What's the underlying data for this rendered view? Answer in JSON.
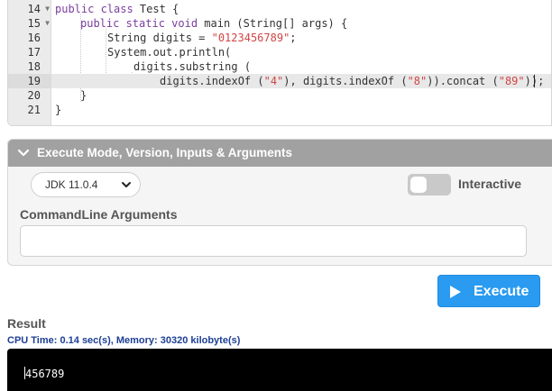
{
  "editor": {
    "lines": [
      {
        "num": "14",
        "fold": true
      },
      {
        "num": "15",
        "fold": true
      },
      {
        "num": "16",
        "fold": false
      },
      {
        "num": "17",
        "fold": false
      },
      {
        "num": "18",
        "fold": false
      },
      {
        "num": "19",
        "fold": false
      },
      {
        "num": "20",
        "fold": false
      },
      {
        "num": "21",
        "fold": false
      }
    ],
    "tokens": {
      "l14_kw": "public class",
      "l14_rest": " Test {",
      "l15_kw": "public static void",
      "l15_rest": " main (String[] args) {",
      "l16_a": "String digits = ",
      "l16_str": "\"0123456789\"",
      "l16_b": ";",
      "l17": "System.out.println(",
      "l18": "digits.substring (",
      "l19_a": "digits.indexOf (",
      "l19_s1": "\"4\"",
      "l19_b": "), digits.indexOf (",
      "l19_s2": "\"8\"",
      "l19_c": ")).concat (",
      "l19_s3": "\"89\"",
      "l19_d": "));",
      "l20": "}",
      "l21": "}"
    }
  },
  "panel": {
    "header": "Execute Mode, Version, Inputs & Arguments",
    "jdk_version": "JDK 11.0.4",
    "interactive_label": "Interactive",
    "interactive_on": false,
    "args_label": "CommandLine Arguments",
    "args_value": ""
  },
  "execute_label": "Execute",
  "result": {
    "title": "Result",
    "stats": "CPU Time: 0.14 sec(s), Memory: 30320 kilobyte(s)",
    "output": "456789"
  },
  "colors": {
    "accent": "#2a9bf0",
    "header_bg": "#a1a1a1",
    "keyword": "#7a3e9d",
    "string": "#d14545",
    "stats": "#1c3f94"
  },
  "icons": [
    "fold-arrow-icon",
    "chevron-down-icon",
    "select-arrow-icon",
    "play-icon"
  ]
}
